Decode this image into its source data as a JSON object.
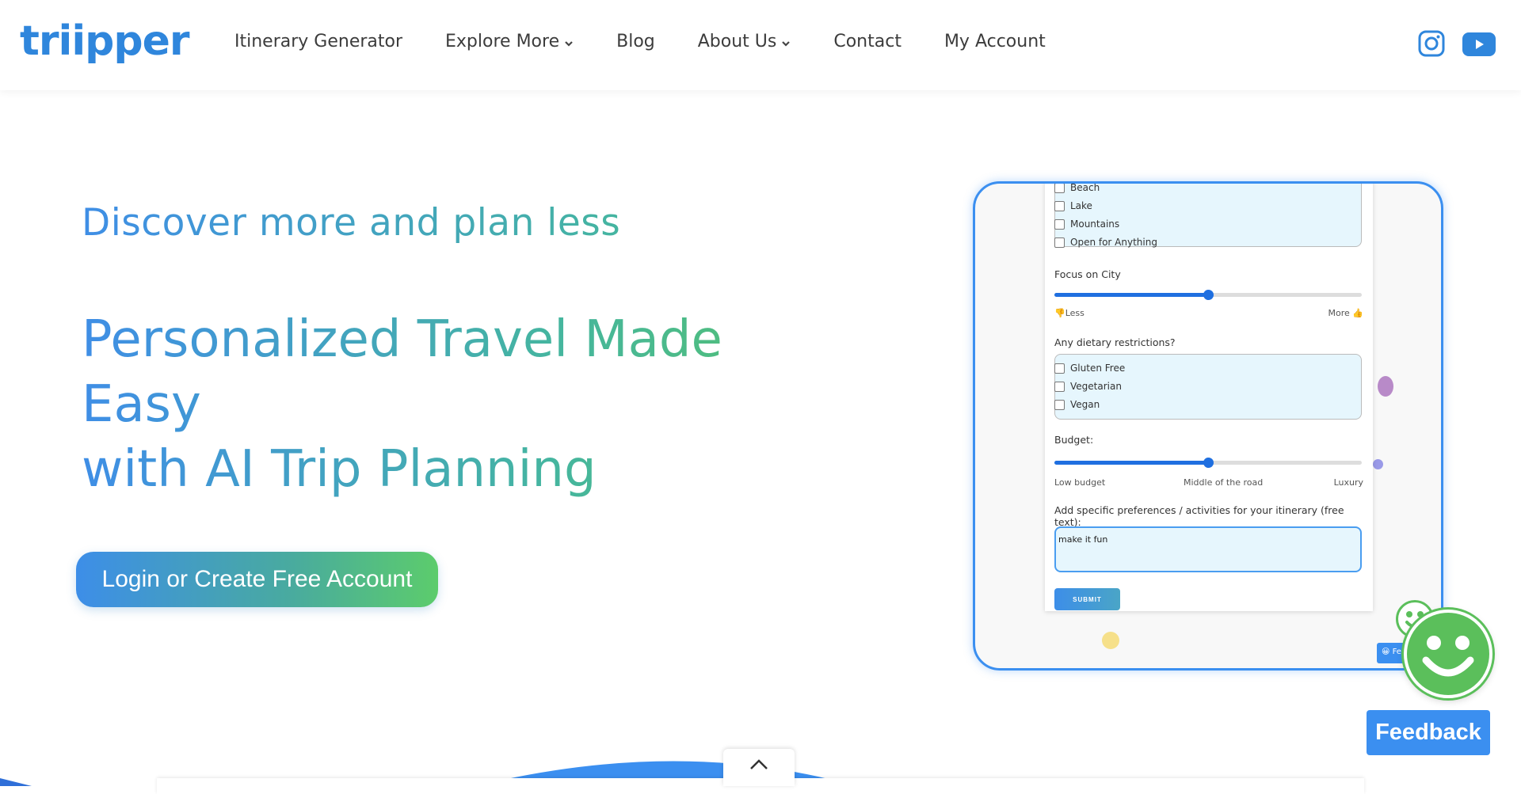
{
  "header": {
    "logo_text": "triipper",
    "nav": [
      {
        "label": "Itinerary Generator",
        "dropdown": false
      },
      {
        "label": "Explore More",
        "dropdown": true
      },
      {
        "label": "Blog",
        "dropdown": false
      },
      {
        "label": "About Us",
        "dropdown": true
      },
      {
        "label": "Contact",
        "dropdown": false
      },
      {
        "label": "My Account",
        "dropdown": false
      }
    ],
    "social": [
      "instagram-icon",
      "youtube-icon"
    ]
  },
  "hero": {
    "subtitle": "Discover more and plan less",
    "title_line1": "Personalized Travel Made Easy",
    "title_line2": "with AI Trip Planning",
    "cta_label": "Login or Create Free Account"
  },
  "preview": {
    "landscape_options": [
      "Beach",
      "Lake",
      "Mountains",
      "Open for Anything"
    ],
    "focus_label": "Focus on City",
    "focus_value": 0.5,
    "focus_min": "👎Less",
    "focus_max": "More 👍",
    "dietary_label": "Any dietary restrictions?",
    "dietary_options": [
      "Gluten Free",
      "Vegetarian",
      "Vegan"
    ],
    "budget_label": "Budget:",
    "budget_value": 0.5,
    "budget_low": "Low budget",
    "budget_mid": "Middle of the road",
    "budget_high": "Luxury",
    "preferences_label": "Add specific preferences / activities for your itinerary (free text):",
    "preferences_value": "make it fun",
    "submit_label": "SUBMIT",
    "mini_feedback": "😀 Fe"
  },
  "feedback": {
    "label": "Feedback"
  },
  "colors": {
    "brand_blue": "#3b8ff0",
    "brand_green": "#5bbf5b",
    "teal": "#45b5a0"
  }
}
